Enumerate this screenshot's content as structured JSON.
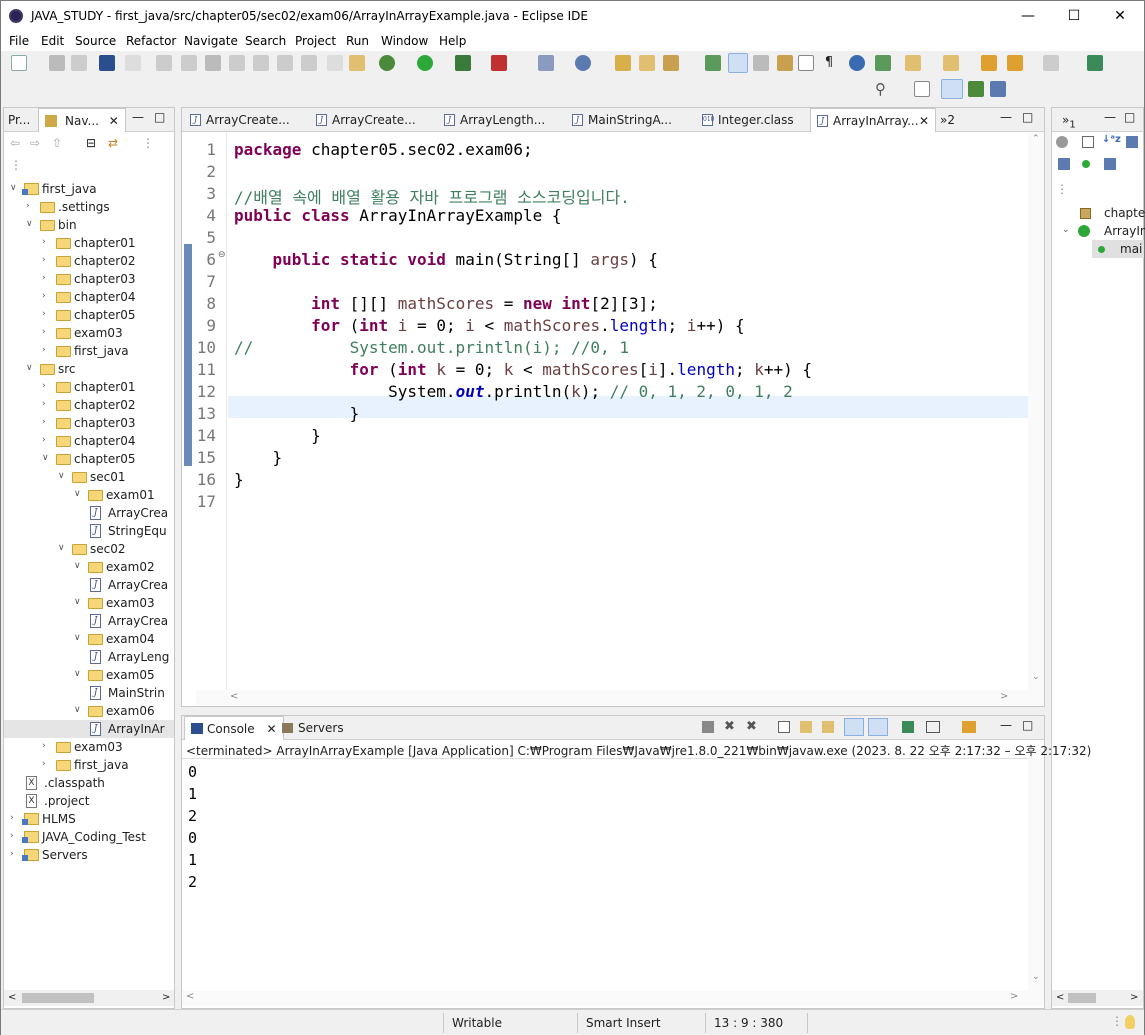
{
  "window": {
    "title": "JAVA_STUDY - first_java/src/chapter05/sec02/exam06/ArrayInArrayExample.java - Eclipse IDE"
  },
  "menu": [
    "File",
    "Edit",
    "Source",
    "Refactor",
    "Navigate",
    "Search",
    "Project",
    "Run",
    "Window",
    "Help"
  ],
  "left_panel": {
    "tabs": [
      "Pr...",
      "Nav..."
    ],
    "tree": [
      {
        "label": "first_java",
        "icon": "project"
      },
      {
        "label": ".settings",
        "icon": "folder"
      },
      {
        "label": "bin",
        "icon": "folder"
      },
      {
        "label": "chapter01",
        "icon": "folder"
      },
      {
        "label": "chapter02",
        "icon": "folder"
      },
      {
        "label": "chapter03",
        "icon": "folder"
      },
      {
        "label": "chapter04",
        "icon": "folder"
      },
      {
        "label": "chapter05",
        "icon": "folder"
      },
      {
        "label": "exam03",
        "icon": "folder"
      },
      {
        "label": "first_java",
        "icon": "folder"
      },
      {
        "label": "src",
        "icon": "folder"
      },
      {
        "label": "chapter01",
        "icon": "folder"
      },
      {
        "label": "chapter02",
        "icon": "folder"
      },
      {
        "label": "chapter03",
        "icon": "folder"
      },
      {
        "label": "chapter04",
        "icon": "folder"
      },
      {
        "label": "chapter05",
        "icon": "folder"
      },
      {
        "label": "sec01",
        "icon": "folder"
      },
      {
        "label": "exam01",
        "icon": "folder"
      },
      {
        "label": "ArrayCrea",
        "icon": "java"
      },
      {
        "label": "StringEqu",
        "icon": "java"
      },
      {
        "label": "sec02",
        "icon": "folder"
      },
      {
        "label": "exam02",
        "icon": "folder"
      },
      {
        "label": "ArrayCrea",
        "icon": "java"
      },
      {
        "label": "exam03",
        "icon": "folder"
      },
      {
        "label": "ArrayCrea",
        "icon": "java"
      },
      {
        "label": "exam04",
        "icon": "folder"
      },
      {
        "label": "ArrayLeng",
        "icon": "java"
      },
      {
        "label": "exam05",
        "icon": "folder"
      },
      {
        "label": "MainStrin",
        "icon": "java"
      },
      {
        "label": "exam06",
        "icon": "folder"
      },
      {
        "label": "ArrayInAr",
        "icon": "java"
      },
      {
        "label": "exam03",
        "icon": "folder"
      },
      {
        "label": "first_java",
        "icon": "folder"
      },
      {
        "label": ".classpath",
        "icon": "xml"
      },
      {
        "label": ".project",
        "icon": "xml"
      },
      {
        "label": "HLMS",
        "icon": "project"
      },
      {
        "label": "JAVA_Coding_Test",
        "icon": "project"
      },
      {
        "label": "Servers",
        "icon": "project"
      }
    ]
  },
  "editor": {
    "tabs": [
      "ArrayCreate...",
      "ArrayCreate...",
      "ArrayLength...",
      "MainStringA...",
      "Integer.class",
      "ArrayInArray..."
    ],
    "overflow": "»2",
    "lines": [
      {
        "n": "1",
        "html": "<span class=\"kw\">package</span> chapter05.sec02.exam06;"
      },
      {
        "n": "2",
        "html": ""
      },
      {
        "n": "3",
        "html": "<span class=\"cm\">//배열 속에 배열 활용 자바 프로그램 소스코딩입니다.</span>"
      },
      {
        "n": "4",
        "html": "<span class=\"kw\">public class</span> ArrayInArrayExample {"
      },
      {
        "n": "5",
        "html": ""
      },
      {
        "n": "6",
        "html": "    <span class=\"kw\">public static void</span> main(String[] <span class=\"var\">args</span>) {"
      },
      {
        "n": "7",
        "html": ""
      },
      {
        "n": "8",
        "html": "        <span class=\"kw\">int</span> [][] <span class=\"var\">mathScores</span> = <span class=\"kw\">new int</span>[2][3];"
      },
      {
        "n": "9",
        "html": "        <span class=\"kw\">for</span> (<span class=\"kw\">int</span> <span class=\"var\">i</span> = 0; <span class=\"var\">i</span> &lt; <span class=\"var\">mathScores</span>.<span class=\"fld\">length</span>; <span class=\"var\">i</span>++) {"
      },
      {
        "n": "10",
        "html": "<span class=\"cm\">//          System.out.println(i); //0, 1</span>"
      },
      {
        "n": "11",
        "html": "            <span class=\"kw\">for</span> (<span class=\"kw\">int</span> <span class=\"var\">k</span> = 0; <span class=\"var\">k</span> &lt; <span class=\"var\">mathScores</span>[<span class=\"var\">i</span>].<span class=\"fld\">length</span>; <span class=\"var\">k</span>++) {"
      },
      {
        "n": "12",
        "html": "                System.<span class=\"sfld\">out</span>.println(<span class=\"var\">k</span>); <span class=\"cm\">// 0, 1, 2, 0, 1, 2</span>"
      },
      {
        "n": "13",
        "html": "            }"
      },
      {
        "n": "14",
        "html": "        }"
      },
      {
        "n": "15",
        "html": "    }"
      },
      {
        "n": "16",
        "html": "}"
      },
      {
        "n": "17",
        "html": ""
      }
    ]
  },
  "outline": {
    "items": [
      "chapter",
      "ArrayIn",
      "mai"
    ]
  },
  "console": {
    "tabs": [
      "Console",
      "Servers"
    ],
    "header": "<terminated> ArrayInArrayExample [Java Application] C:₩Program Files₩Java₩jre1.8.0_221₩bin₩javaw.exe  (2023. 8. 22 오후 2:17:32 – 오후 2:17:32)",
    "output": [
      "0",
      "1",
      "2",
      "0",
      "1",
      "2"
    ]
  },
  "status": {
    "writable": "Writable",
    "insert_mode": "Smart Insert",
    "position": "13 : 9 : 380"
  }
}
